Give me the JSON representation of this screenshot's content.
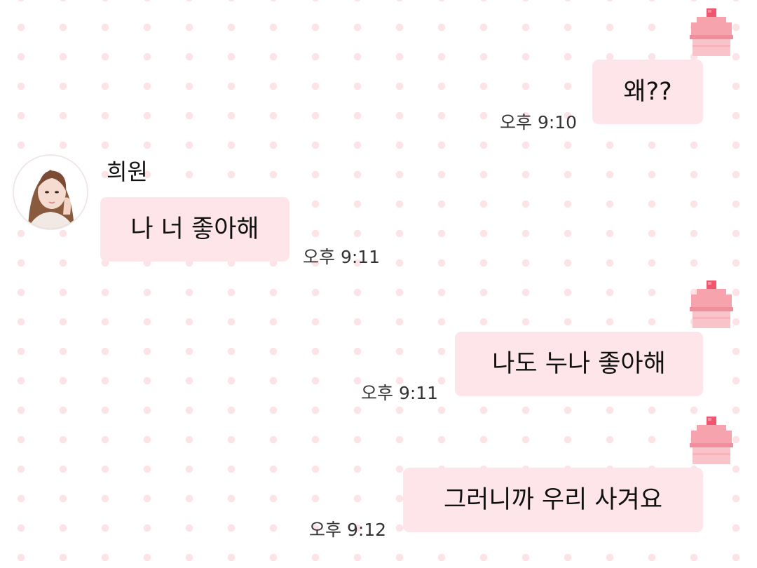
{
  "chat": {
    "contact_name": "희원",
    "messages": [
      {
        "side": "right",
        "text": "왜??",
        "time": "오후 9:10"
      },
      {
        "side": "left",
        "text": "나 너 좋아해",
        "time": "오후 9:11"
      },
      {
        "side": "right",
        "text": "나도 누나 좋아해",
        "time": "오후 9:11"
      },
      {
        "side": "right",
        "text": "그러니까 우리 사겨요",
        "time": "오후 9:12"
      }
    ]
  },
  "colors": {
    "bubble": "#fde5e9",
    "dots": "#fbe3e6",
    "cupcake_cherry": "#f2566f",
    "cupcake_frosting": "#f7a3ad",
    "cupcake_base": "#f9c4c9"
  }
}
